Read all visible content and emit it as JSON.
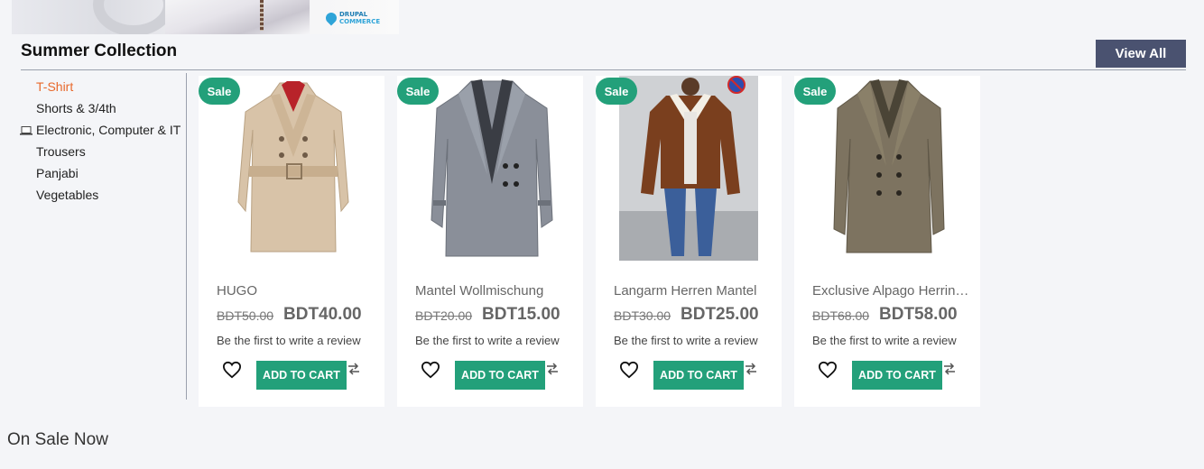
{
  "banner": {
    "logo_line1": "DRUPAL",
    "logo_line2": "COMMERCE"
  },
  "section": {
    "title": "Summer Collection",
    "view_all_label": "View All",
    "categories": [
      {
        "label": "T-Shirt",
        "active": true
      },
      {
        "label": "Shorts & 3/4th"
      },
      {
        "label": "Electronic, Computer & IT",
        "icon": "laptop-icon"
      },
      {
        "label": "Trousers"
      },
      {
        "label": "Panjabi"
      },
      {
        "label": "Vegetables"
      }
    ],
    "products": [
      {
        "badge": "Sale",
        "name": "HUGO",
        "old_price": "BDT50.00",
        "price": "BDT40.00",
        "review": "Be the first to write a review",
        "cart_label": "ADD TO CART"
      },
      {
        "badge": "Sale",
        "name": "Mantel Wollmischung",
        "old_price": "BDT20.00",
        "price": "BDT15.00",
        "review": "Be the first to write a review",
        "cart_label": "ADD TO CART"
      },
      {
        "badge": "Sale",
        "name": "Langarm Herren Mantel",
        "old_price": "BDT30.00",
        "price": "BDT25.00",
        "review": "Be the first to write a review",
        "cart_label": "ADD TO CART"
      },
      {
        "badge": "Sale",
        "name": "Exclusive Alpago Herringbone Coat",
        "old_price": "BDT68.00",
        "price": "BDT58.00",
        "review": "Be the first to write a review",
        "cart_label": "ADD TO CART"
      }
    ]
  },
  "on_sale_title": "On Sale Now",
  "colors": {
    "accent": "#23a07a",
    "active_category": "#e8692c",
    "view_all_bg": "#4a5270"
  }
}
